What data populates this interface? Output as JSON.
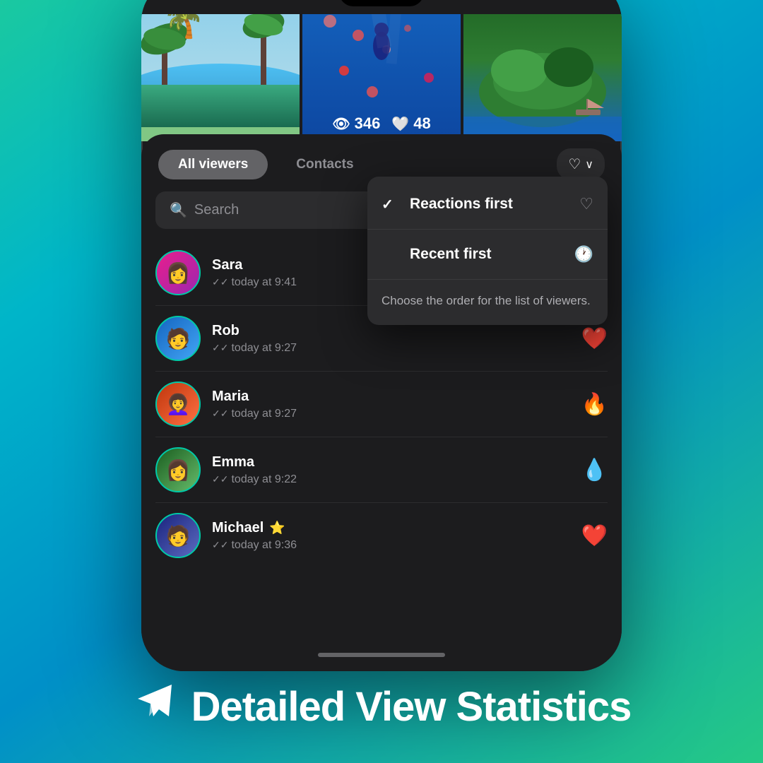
{
  "background": {
    "gradient_start": "#1ac9a0",
    "gradient_end": "#25c985"
  },
  "stats": {
    "views": "346",
    "likes": "48"
  },
  "tabs": {
    "active": "All viewers",
    "inactive": "Contacts"
  },
  "sort_button": {
    "label": "♡ ∨"
  },
  "search": {
    "placeholder": "Search"
  },
  "viewers": [
    {
      "name": "Sara",
      "time": "today at 9:41",
      "reaction": "",
      "avatar_color": "sara",
      "star": false
    },
    {
      "name": "Rob",
      "time": "today at 9:27",
      "reaction": "❤️",
      "avatar_color": "rob",
      "star": false
    },
    {
      "name": "Maria",
      "time": "today at 9:27",
      "reaction": "🔥",
      "avatar_color": "maria",
      "star": false
    },
    {
      "name": "Emma",
      "time": "today at 9:22",
      "reaction": "💧",
      "avatar_color": "emma",
      "star": false
    },
    {
      "name": "Michael",
      "time": "today at 9:36",
      "reaction": "❤️",
      "avatar_color": "michael",
      "star": true
    }
  ],
  "dropdown": {
    "items": [
      {
        "id": "reactions-first",
        "label": "Reactions first",
        "icon": "♡",
        "checked": true
      },
      {
        "id": "recent-first",
        "label": "Recent first",
        "icon": "🕐",
        "checked": false
      }
    ],
    "tip": "Choose the order for the list of viewers."
  },
  "footer": {
    "icon": "✈",
    "text": "Detailed View Statistics"
  }
}
